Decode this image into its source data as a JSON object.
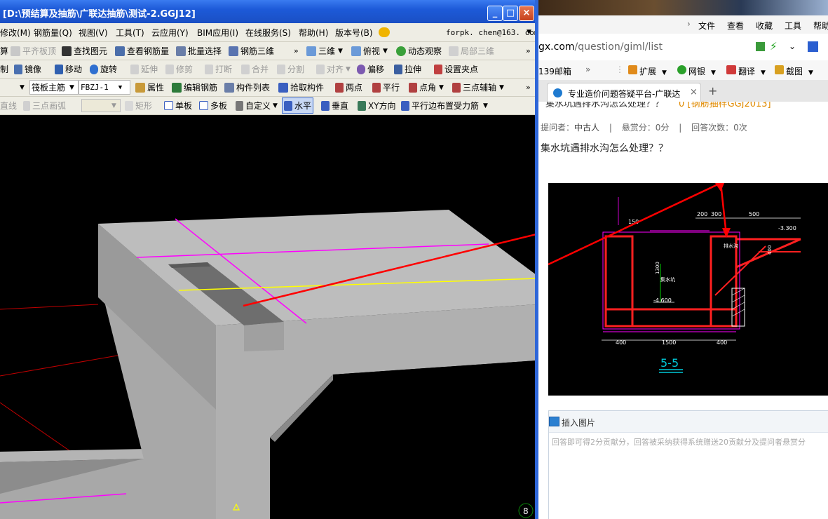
{
  "window": {
    "title": "[D:\\预结算及抽筋\\广联达抽筋\\测试-2.GGJ12]",
    "min": "_",
    "max": "□",
    "close": "×"
  },
  "menubar": {
    "items": [
      "修改(M)",
      "钢筋量(Q)",
      "视图(V)",
      "工具(T)",
      "云应用(Y)",
      "BIM应用(I)",
      "在线服务(S)",
      "帮助(H)",
      "版本号(B)"
    ],
    "account": "forpk. chen@163. com"
  },
  "toolbar1": {
    "items": [
      "算",
      "平齐板顶",
      "查找图元",
      "查看钢筋量",
      "批量选择",
      "钢筋三维",
      "三维",
      "俯视",
      "动态观察",
      "局部三维"
    ]
  },
  "toolbar2": {
    "items": [
      "制",
      "镜像",
      "移动",
      "旋转",
      "延伸",
      "修剪",
      "打断",
      "合并",
      "分割",
      "对齐",
      "偏移",
      "拉伸",
      "设置夹点"
    ]
  },
  "toolbar3": {
    "select1": "筏板主筋",
    "select2": "FBZJ-1",
    "items": [
      "属性",
      "编辑钢筋",
      "构件列表",
      "拾取构件",
      "两点",
      "平行",
      "点角",
      "三点辅轴"
    ]
  },
  "toolbar4": {
    "items": [
      "直线",
      "三点画弧",
      "矩形",
      "单板",
      "多板",
      "自定义",
      "水平",
      "垂直",
      "XY方向",
      "平行边布置受力筋"
    ]
  },
  "browser": {
    "menu": [
      "文件",
      "查看",
      "收藏",
      "工具",
      "帮助"
    ],
    "url_host": "gx.com",
    "url_path": "/question/giml/list",
    "favorites": [
      "139邮箱",
      "扩展",
      "网银",
      "翻译",
      "截图"
    ],
    "tab_title": "专业造价问题答疑平台-广联达",
    "tab_new": "+"
  },
  "question": {
    "cut_title": "集水坑遇排水沟怎么处理？？",
    "cut_tag": "0 [钢筋抽样GGJ2013]",
    "meta_asker_label": "提问者：",
    "meta_asker": "中古人",
    "meta_reward": "悬赏分：0分",
    "meta_answers": "回答次数：0次",
    "title": "集水坑遇排水沟怎么处理？？"
  },
  "drawing": {
    "label": "5-5",
    "dims": [
      "200",
      "300",
      "500",
      "150",
      "400",
      "1500",
      "400",
      "1300",
      "400",
      "-3.300",
      "-4.600"
    ],
    "notes": [
      "集水坑",
      "排水沟"
    ]
  },
  "answer": {
    "insert_image": "插入图片",
    "placeholder": "回答即可得2分贡献分，回答被采纳获得系统赠送20贡献分及提问者悬赏分"
  },
  "colors": {
    "xp_blue": "#1d5ad8",
    "toolbar_bg": "#eeede4",
    "magenta": "#ff00ff",
    "yellow": "#ffff00",
    "annotation_red": "#ff0000"
  }
}
